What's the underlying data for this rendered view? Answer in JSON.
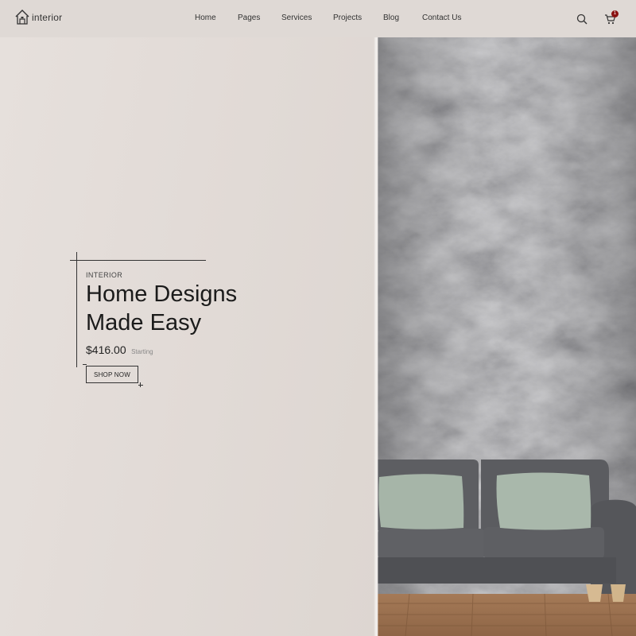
{
  "brand": {
    "name": "interior",
    "icon": "house-logo-icon"
  },
  "nav": {
    "items": [
      {
        "label": "Home"
      },
      {
        "label": "Pages"
      },
      {
        "label": "Services"
      },
      {
        "label": "Projects"
      },
      {
        "label": "Blog"
      },
      {
        "label": "Contact Us"
      }
    ]
  },
  "header_actions": {
    "search_icon": "search-icon",
    "cart_icon": "cart-icon",
    "cart_count": "1",
    "badge_color": "#8a1212"
  },
  "hero": {
    "eyebrow": "INTERIOR",
    "title_line1": "Home Designs",
    "title_line2": "Made Easy",
    "price": "$416.00",
    "price_note": "Starting",
    "cta": "SHOP NOW",
    "image": "gray-sofa-against-concrete-wall"
  }
}
